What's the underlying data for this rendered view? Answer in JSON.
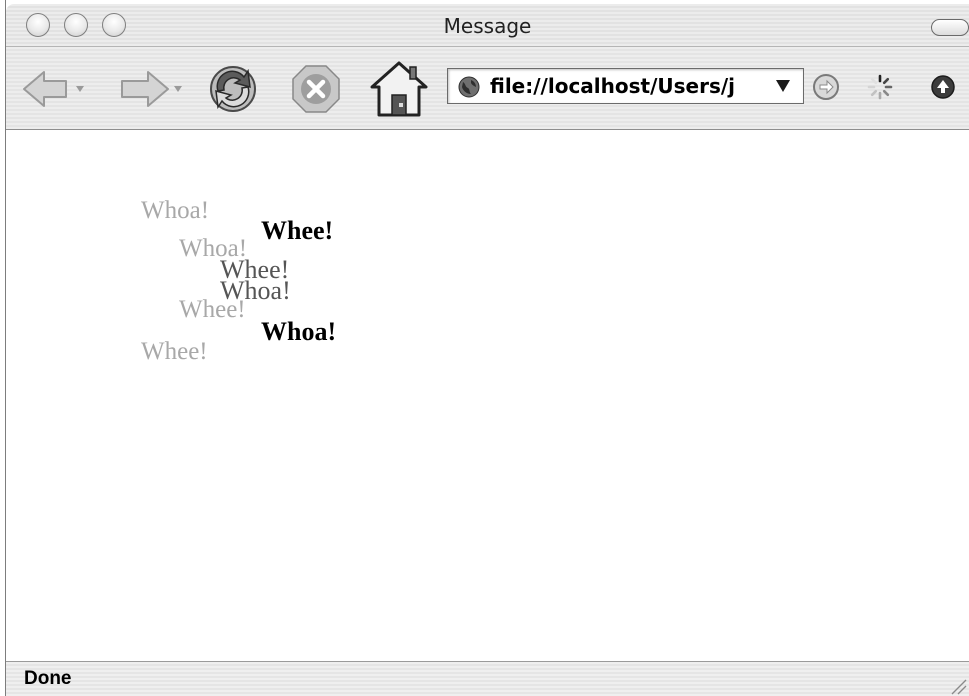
{
  "window": {
    "title": "Message"
  },
  "toolbar": {
    "back_icon": "back-arrow-icon",
    "forward_icon": "forward-arrow-icon",
    "reload_icon": "reload-icon",
    "stop_icon": "stop-icon",
    "home_icon": "home-icon",
    "address": "file://localhost/Users/j",
    "go_icon": "go-icon",
    "spinner_icon": "loading-spinner-icon",
    "bookmark_icon": "bookmark-icon"
  },
  "content": {
    "messages": [
      {
        "text": "Whoa!",
        "style": "faint"
      },
      {
        "text": "Whee!",
        "style": "bold"
      },
      {
        "text": "Whoa!",
        "style": "faint"
      },
      {
        "text": "Whee!",
        "style": "mid"
      },
      {
        "text": "Whoa!",
        "style": "mid"
      },
      {
        "text": "Whee!",
        "style": "faint"
      },
      {
        "text": "Whoa!",
        "style": "bold"
      },
      {
        "text": "Whee!",
        "style": "faint"
      }
    ]
  },
  "status": {
    "text": "Done"
  }
}
